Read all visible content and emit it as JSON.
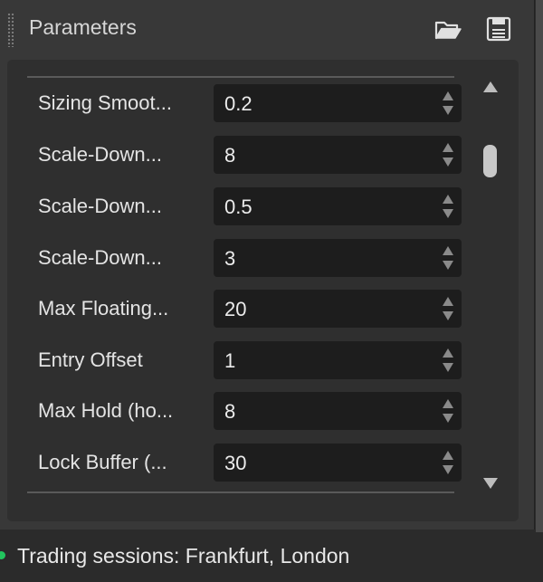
{
  "panel": {
    "title": "Parameters",
    "open_icon": "folder-open-icon",
    "save_icon": "floppy-save-icon"
  },
  "params": [
    {
      "label": "Sizing Smoot...",
      "value": "0.2"
    },
    {
      "label": "Scale-Down...",
      "value": "8"
    },
    {
      "label": "Scale-Down...",
      "value": "0.5"
    },
    {
      "label": "Scale-Down...",
      "value": "3"
    },
    {
      "label": "Max Floating...",
      "value": "20"
    },
    {
      "label": "Entry Offset",
      "value": "1"
    },
    {
      "label": "Max Hold (ho...",
      "value": "8"
    },
    {
      "label": "Lock Buffer (...",
      "value": "30"
    }
  ],
  "scrollbar": {
    "up_icon": "triangle-up-icon",
    "down_icon": "triangle-down-icon"
  },
  "status": {
    "text": "Trading sessions: Frankfurt, London",
    "indicator_color": "#22c55e"
  },
  "colors": {
    "panel_bg": "#383838",
    "inner_bg": "#2f2f2f",
    "field_bg": "#1d1d1d",
    "text": "#e4e4e4"
  }
}
